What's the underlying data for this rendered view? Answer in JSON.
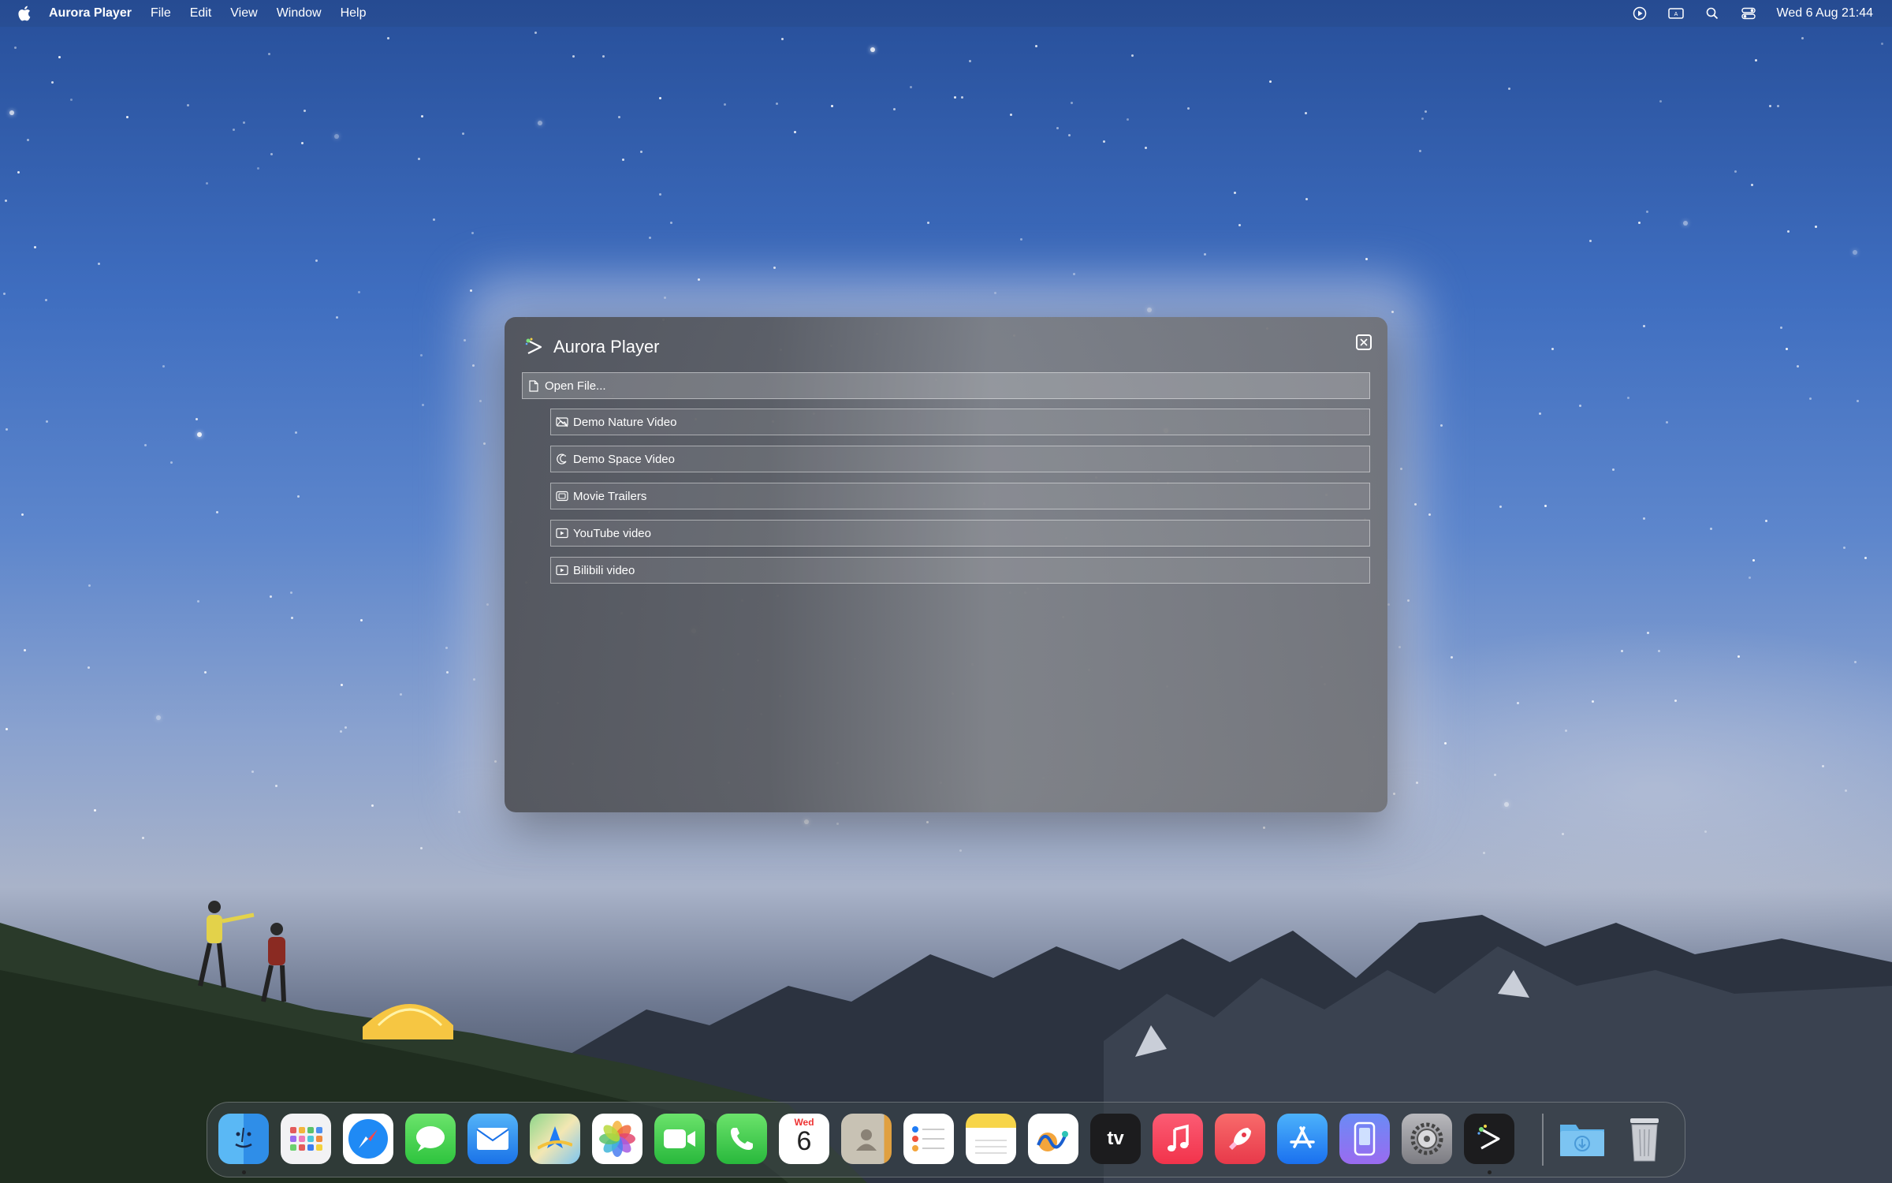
{
  "menubar": {
    "app_name": "Aurora Player",
    "items": [
      "File",
      "Edit",
      "View",
      "Window",
      "Help"
    ],
    "clock": "Wed 6 Aug 21:44"
  },
  "window": {
    "title": "Aurora Player",
    "open_file_label": "Open File...",
    "items": [
      {
        "label": "Demo Nature Video",
        "icon": "nature-icon"
      },
      {
        "label": "Demo Space Video",
        "icon": "space-icon"
      },
      {
        "label": "Movie Trailers",
        "icon": "film-icon"
      },
      {
        "label": "YouTube video",
        "icon": "play-icon"
      },
      {
        "label": "Bilibili video",
        "icon": "play-icon"
      }
    ]
  },
  "dock": {
    "apps": [
      "Finder",
      "Launchpad",
      "Safari",
      "Messages",
      "Mail",
      "Maps",
      "Photos",
      "FaceTime",
      "Phone",
      "Calendar",
      "Contacts",
      "Reminders",
      "Notes",
      "Freeform",
      "TV",
      "Music",
      "Rocket",
      "App Store",
      "iPhone Mirroring",
      "System Settings",
      "Aurora Player",
      "Downloads",
      "Trash"
    ],
    "calendar_day": "Wed",
    "calendar_date": "6",
    "tv_label": "tv"
  },
  "colors": {
    "accent_blue": "#1f7cf5",
    "window_bg": "#55575c"
  }
}
